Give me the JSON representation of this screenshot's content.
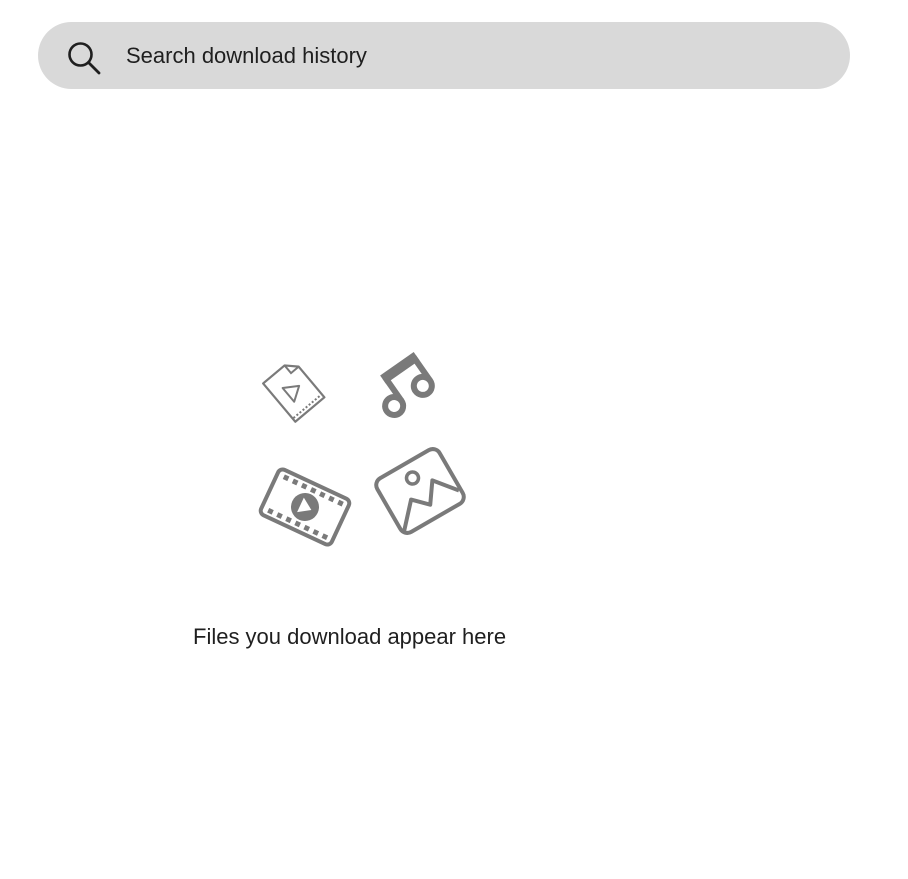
{
  "search": {
    "placeholder": "Search download history",
    "icon": "search-icon"
  },
  "empty_state": {
    "message": "Files you download appear here",
    "icons": [
      "document-play-icon",
      "music-note-icon",
      "film-reel-icon",
      "image-icon"
    ]
  },
  "colors": {
    "search_bg": "#d9d9d9",
    "icon_gray": "#7a7a7a",
    "text": "#1f1f1f"
  }
}
